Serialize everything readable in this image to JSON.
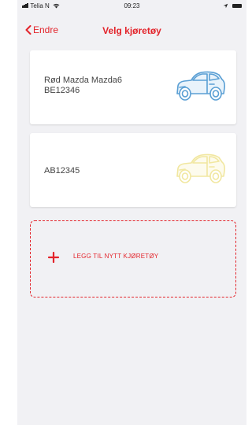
{
  "status_bar": {
    "carrier": "Telia N",
    "time": "09:23"
  },
  "navbar": {
    "back_label": "Endre",
    "title": "Velg kjøretøy"
  },
  "vehicles": [
    {
      "name": "Rød Mazda Mazda6",
      "plate": "BE12346",
      "icon": "car-icon",
      "icon_color": "#5a9fd4"
    },
    {
      "name": "",
      "plate": "AB12345",
      "icon": "car-icon",
      "icon_color": "#f1e7a0"
    }
  ],
  "add_vehicle": {
    "label": "LEGG TIL NYTT KJØRETØY",
    "icon": "plus-icon"
  },
  "colors": {
    "accent": "#e3242b",
    "background": "#f1f1f4",
    "card": "#ffffff"
  }
}
